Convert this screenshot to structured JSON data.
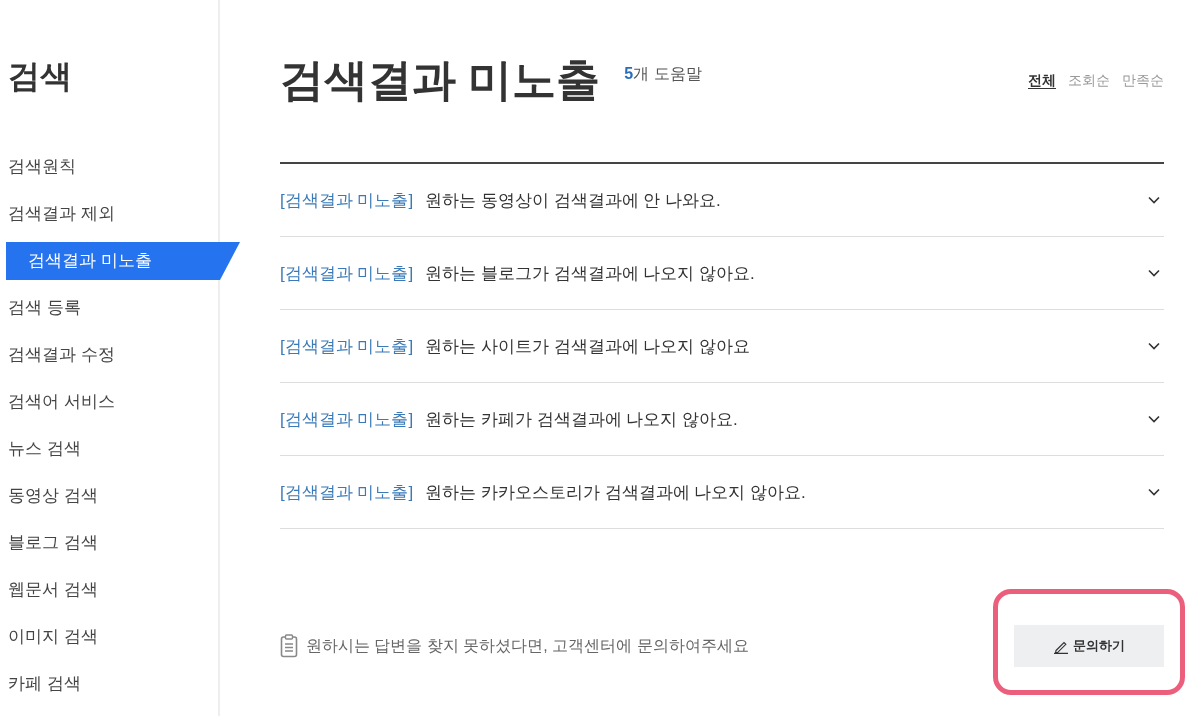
{
  "sidebar": {
    "title": "검색",
    "items": [
      {
        "label": "검색원칙",
        "selected": false
      },
      {
        "label": "검색결과 제외",
        "selected": false
      },
      {
        "label": "검색결과 미노출",
        "selected": true
      },
      {
        "label": "검색 등록",
        "selected": false
      },
      {
        "label": "검색결과 수정",
        "selected": false
      },
      {
        "label": "검색어 서비스",
        "selected": false
      },
      {
        "label": "뉴스 검색",
        "selected": false
      },
      {
        "label": "동영상 검색",
        "selected": false
      },
      {
        "label": "블로그 검색",
        "selected": false
      },
      {
        "label": "웹문서 검색",
        "selected": false
      },
      {
        "label": "이미지 검색",
        "selected": false
      },
      {
        "label": "카페 검색",
        "selected": false
      }
    ]
  },
  "header": {
    "title": "검색결과 미노출",
    "count": "5",
    "count_unit": "개 도움말",
    "sort_tabs": [
      {
        "label": "전체",
        "selected": true
      },
      {
        "label": "조회순",
        "selected": false
      },
      {
        "label": "만족순",
        "selected": false
      }
    ]
  },
  "faq": [
    {
      "category": "[검색결과 미노출]",
      "question": "원하는 동영상이 검색결과에 안 나와요.",
      "expanded": false
    },
    {
      "category": "[검색결과 미노출]",
      "question": "원하는 블로그가 검색결과에 나오지 않아요.",
      "expanded": false
    },
    {
      "category": "[검색결과 미노출]",
      "question": "원하는 사이트가 검색결과에 나오지 않아요",
      "expanded": false
    },
    {
      "category": "[검색결과 미노출]",
      "question": "원하는 카페가 검색결과에 나오지 않아요.",
      "expanded": false
    },
    {
      "category": "[검색결과 미노출]",
      "question": "원하는 카카오스토리가 검색결과에 나오지 않아요.",
      "expanded": false
    }
  ],
  "footer": {
    "note": "원하시는 답변을 찾지 못하셨다면, 고객센터에 문의하여주세요",
    "button": "문의하기",
    "highlighted": true
  }
}
